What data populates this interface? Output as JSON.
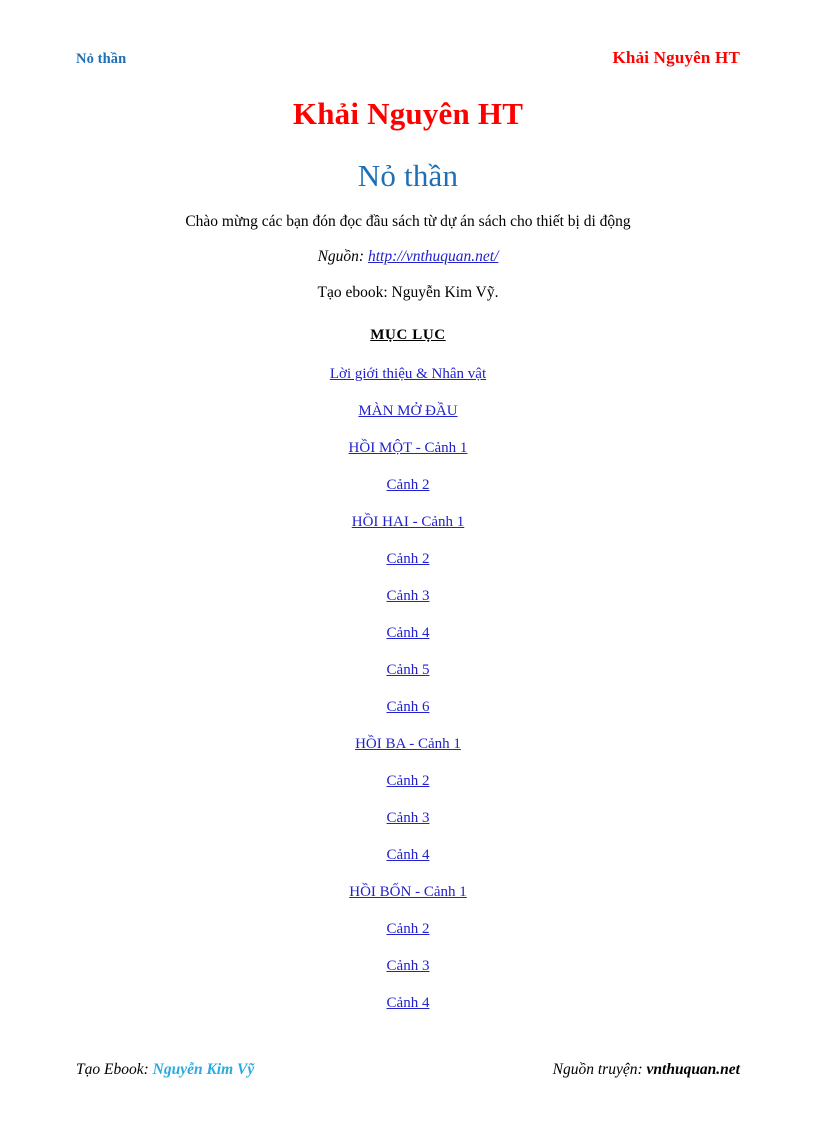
{
  "header": {
    "left_title": "Nỏ thần",
    "right_author": "Khải Nguyên HT"
  },
  "title_block": {
    "author": "Khải Nguyên HT",
    "book_title": "Nỏ thần"
  },
  "intro": {
    "welcome": "Chào mừng các bạn đón đọc đầu sách từ dự án sách cho thiết bị di động",
    "source_label": "Nguồn: ",
    "source_url": "http://vnthuquan.net/",
    "maker": "Tạo ebook: Nguyễn Kim Vỹ."
  },
  "toc": {
    "heading": "MỤC LỤC",
    "items": [
      {
        "label": "Lời giới thiệu & Nhân vật"
      },
      {
        "label": "MÀN MỞ ĐẦU"
      },
      {
        "label": "HỒI MỘT - Cảnh 1"
      },
      {
        "label": "Cảnh 2"
      },
      {
        "label": "HỒI HAI - Cảnh 1"
      },
      {
        "label": "Cảnh 2"
      },
      {
        "label": "Cảnh 3"
      },
      {
        "label": "Cảnh 4"
      },
      {
        "label": "Cảnh 5"
      },
      {
        "label": "Cảnh 6"
      },
      {
        "label": "HỒI BA - Cảnh 1"
      },
      {
        "label": "Cảnh 2"
      },
      {
        "label": "Cảnh 3"
      },
      {
        "label": "Cảnh 4"
      },
      {
        "label": "HỒI BỐN - Cảnh 1"
      },
      {
        "label": "Cảnh 2"
      },
      {
        "label": "Cảnh 3"
      },
      {
        "label": "Cảnh 4"
      }
    ]
  },
  "footer": {
    "ebook_label": "Tạo Ebook: ",
    "ebook_author": "Nguyễn Kim Vỹ",
    "source_label": "Nguồn truyện: ",
    "source_name": "vnthuquan.net"
  },
  "colors": {
    "accent_red": "#FF0000",
    "title_blue": "#1F6FB5",
    "link_blue": "#2222CC",
    "footer_author_blue": "#29ABE2",
    "text_black": "#000000",
    "page_background": "#FFFFFF"
  }
}
